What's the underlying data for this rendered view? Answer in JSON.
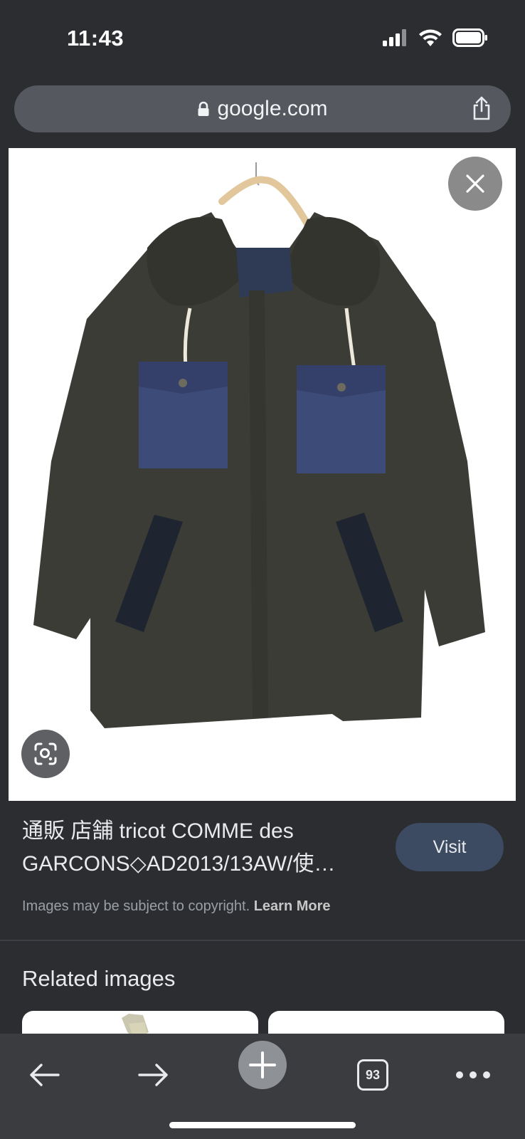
{
  "status": {
    "time": "11:43"
  },
  "browser": {
    "url": "google.com"
  },
  "result": {
    "title": "通販 店舗 tricot COMME des GARCONS◇AD2013/13AW/使…",
    "visit_label": "Visit",
    "copyright_text": "Images may be subject to copyright.",
    "learn_more": "Learn More"
  },
  "related": {
    "heading": "Related images"
  },
  "toolbar": {
    "tabs_count": "93"
  },
  "icons": {
    "lock": "lock-icon",
    "share": "share-icon",
    "close": "close-icon",
    "lens": "lens-icon",
    "back": "back-arrow-icon",
    "forward": "forward-arrow-icon",
    "new_tab": "plus-icon",
    "menu": "more-dots-icon"
  },
  "colors": {
    "background": "#2b2d31",
    "url_bar": "#55585e",
    "visit_button": "#3c4a62",
    "toolbar": "#3a3c40"
  }
}
